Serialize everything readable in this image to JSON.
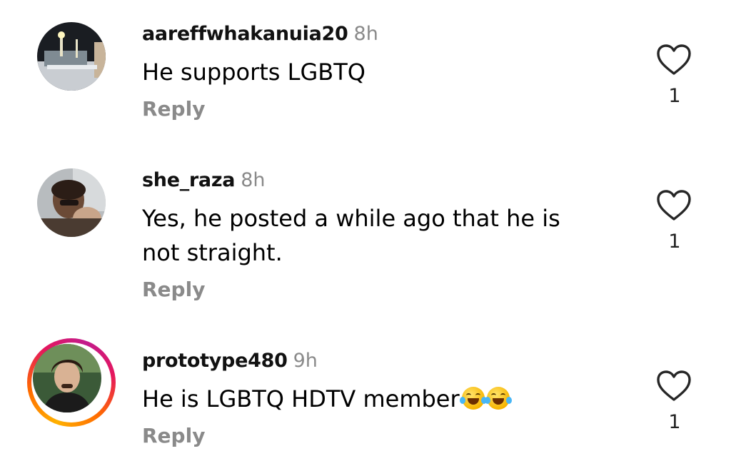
{
  "comments": [
    {
      "username": "aareffwhakanuia20",
      "time": "8h",
      "text_lines": [
        "He supports LGBTQ"
      ],
      "reply_label": "Reply",
      "likes": "1",
      "avatar_icon": "avatar-photo",
      "has_story_ring": false
    },
    {
      "username": "she_raza",
      "time": "8h",
      "text_lines": [
        "Yes, he posted a while ago that he is",
        "not straight."
      ],
      "reply_label": "Reply",
      "likes": "1",
      "avatar_icon": "avatar-photo",
      "has_story_ring": false
    },
    {
      "username": "prototype480",
      "time": "9h",
      "text_lines": [
        "He is LGBTQ HDTV member"
      ],
      "text_emoji": [
        "face-with-tears-of-joy",
        "face-with-tears-of-joy"
      ],
      "reply_label": "Reply",
      "likes": "1",
      "avatar_icon": "avatar-photo",
      "has_story_ring": true
    }
  ],
  "colors": {
    "text": "#000000",
    "secondary": "#8a8a8a",
    "story_ring_start": "#ffb100",
    "story_ring_end": "#c21b8c"
  }
}
